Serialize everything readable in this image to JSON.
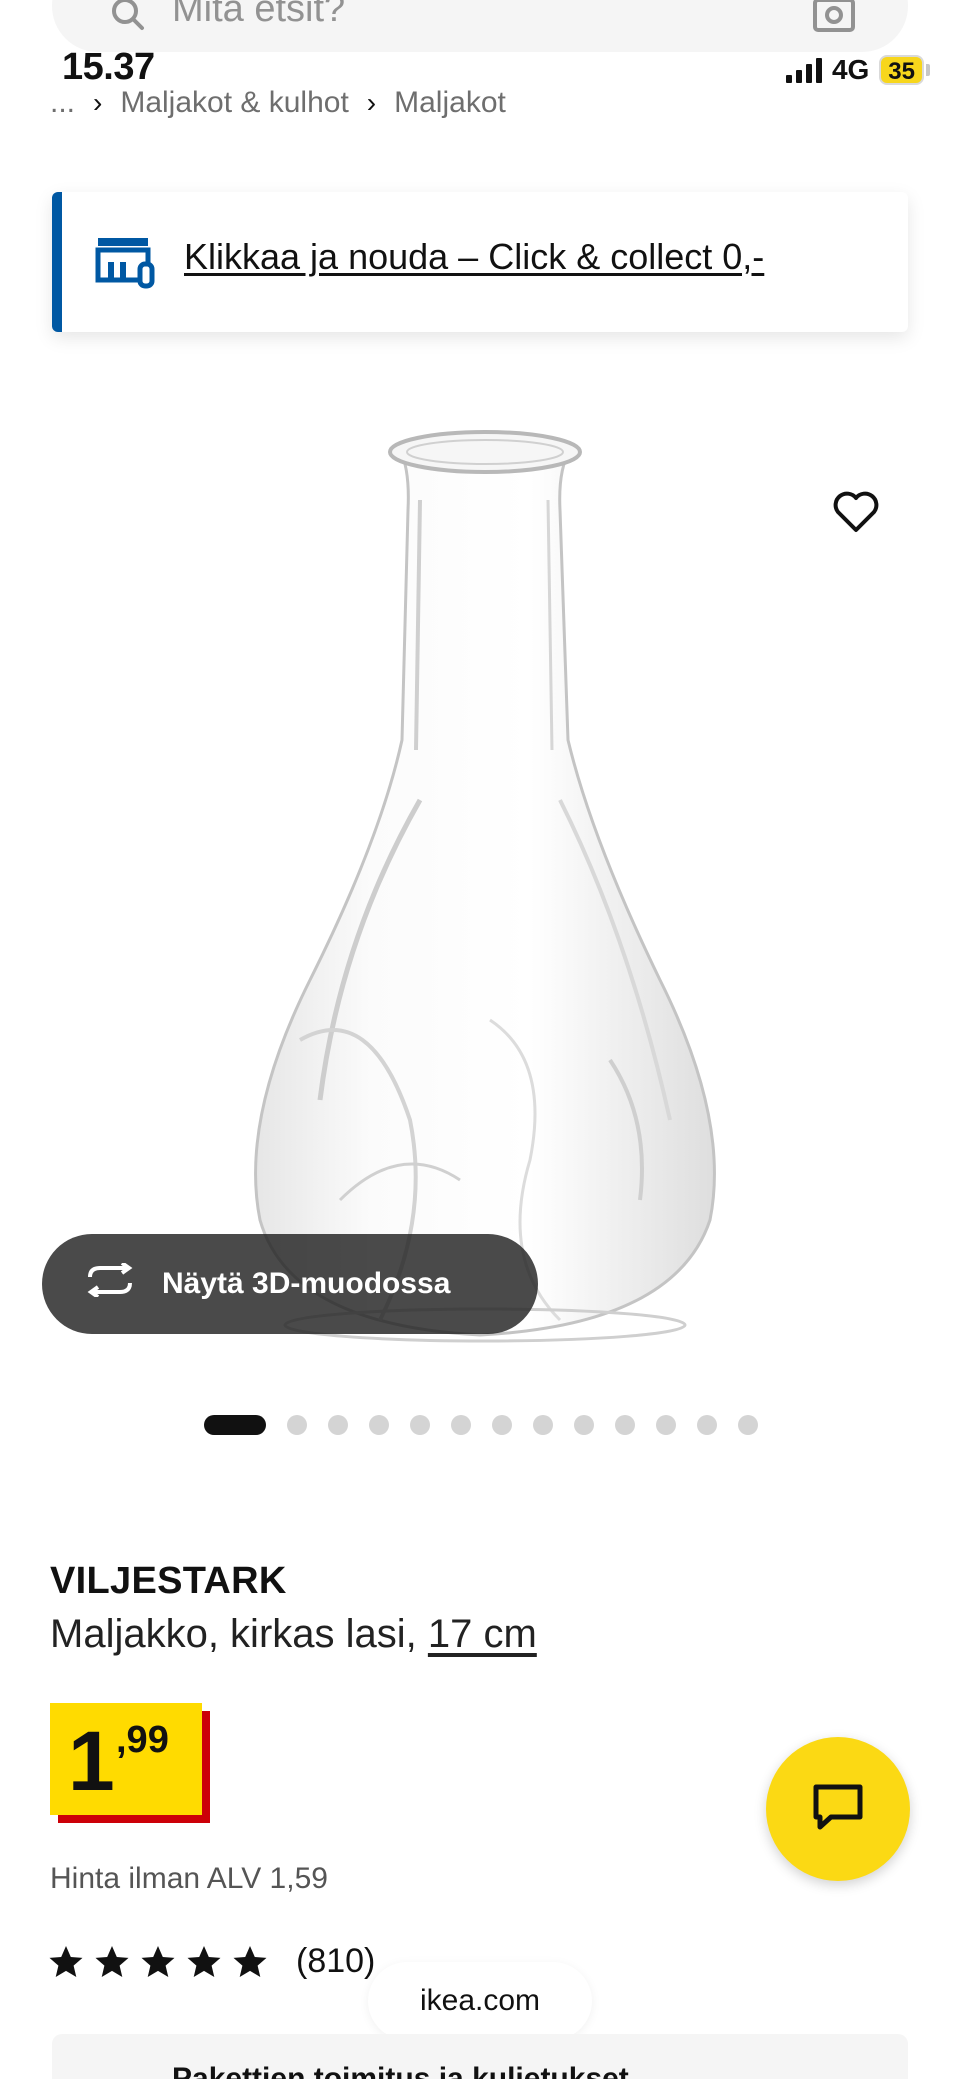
{
  "status_bar": {
    "time": "15.37",
    "network": "4G",
    "battery": "35"
  },
  "search": {
    "placeholder": "Mitä etsit?"
  },
  "breadcrumb": {
    "ellipsis": "...",
    "items": [
      "Maljakot & kulhot",
      "Maljakot"
    ]
  },
  "click_collect": {
    "text": "Klikkaa ja nouda – Click & collect 0,-"
  },
  "media": {
    "view_3d_label": "Näytä 3D-muodossa",
    "dot_count": 13,
    "active_dot": 0
  },
  "product": {
    "name": "VILJESTARK",
    "description": "Maljakko, kirkas lasi, ",
    "size_link": "17 cm",
    "price_integer": "1",
    "price_decimal": ",99",
    "vat_note": "Hinta ilman ALV 1,59",
    "rating_stars": 5,
    "review_count": "(810)"
  },
  "browser": {
    "domain": "ikea.com"
  },
  "bottom_card": {
    "peek_text": "Pakettien toimitus ja kuljetukset"
  },
  "colors": {
    "ikea_blue": "#0058a3",
    "ikea_yellow": "#ffdb00",
    "price_red": "#cc0008",
    "chat_yellow": "#fbd914"
  }
}
